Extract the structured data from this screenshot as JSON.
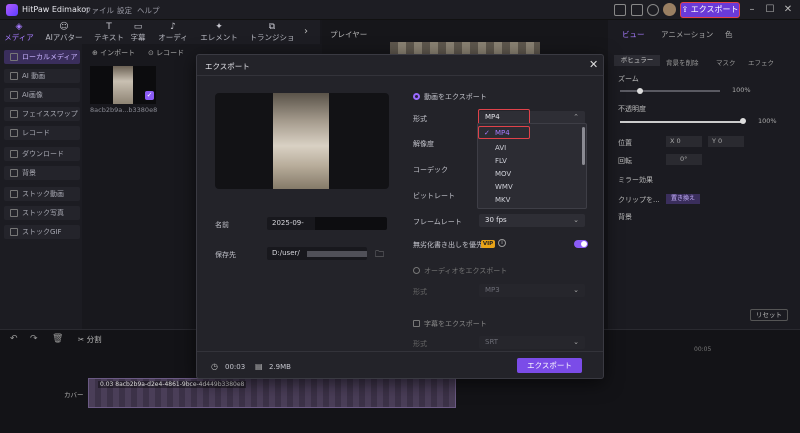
{
  "app": {
    "name": "HitPaw Edimakor",
    "menus": [
      "ファイル",
      "設定",
      "ヘルプ"
    ],
    "export_label": "エクスポート"
  },
  "tools": [
    "メディア",
    "AIアバター",
    "テキスト",
    "字幕",
    "オーディオ",
    "エレメント",
    "トランジション"
  ],
  "sidebar": [
    "ローカルメディア",
    "AI 動画",
    "AI画像",
    "フェイススワップ",
    "レコード",
    "ダウンロード",
    "背景",
    "ストック動画",
    "ストック写真",
    "ストックGIF"
  ],
  "media": {
    "import_label": "インポート",
    "record_label": "レコード",
    "clip_name": "8acb2b9a...b3380e8"
  },
  "player": {
    "label": "プレイヤー"
  },
  "props": {
    "tabs": [
      "ビュー",
      "アニメーション",
      "色"
    ],
    "subtabs": [
      "ボヒュラー",
      "背景を削除",
      "マスク",
      "エフェク"
    ],
    "zoom_label": "ズーム",
    "zoom_value": "100%",
    "opacity_label": "不透明度",
    "opacity_value": "100%",
    "position_label": "位置",
    "pos_x": "0",
    "pos_y": "0",
    "rotate_label": "回転",
    "rotate_value": "0°",
    "mirror_label": "ミラー効果",
    "clip_label": "クリップを...",
    "replace_label": "置き換え",
    "bg_label": "背景",
    "reset_label": "リセット"
  },
  "timeline": {
    "split_label": "分割",
    "cover_label": "カバー",
    "clip_label": "0.03 8acb2b9a-d2e4-4861-9bce-4d449b3380e8",
    "time_mark": "00:05"
  },
  "modal": {
    "title": "エクスポート",
    "name_label": "名前",
    "name_value": "2025-09-",
    "save_label": "保存先",
    "save_value": "D:/user/",
    "export_video_label": "動画をエクスポート",
    "format_label": "形式",
    "format_value": "MP4",
    "resolution_label": "解像度",
    "codec_label": "コーデック",
    "bitrate_label": "ビットレート",
    "framerate_label": "フレームレート",
    "framerate_value": "30  fps",
    "priority_label": "無劣化書き出しを優先",
    "vip_label": "VIP",
    "format_options": [
      "MP4",
      "AVI",
      "FLV",
      "MOV",
      "WMV",
      "MKV"
    ],
    "export_audio_label": "オーディオをエクスポート",
    "audio_format_label": "形式",
    "audio_format_value": "MP3",
    "export_sub_label": "字幕をエクスポート",
    "sub_format_label": "形式",
    "sub_format_value": "SRT",
    "duration": "00:03",
    "size": "2.9MB",
    "export_button": "エクスポート"
  }
}
